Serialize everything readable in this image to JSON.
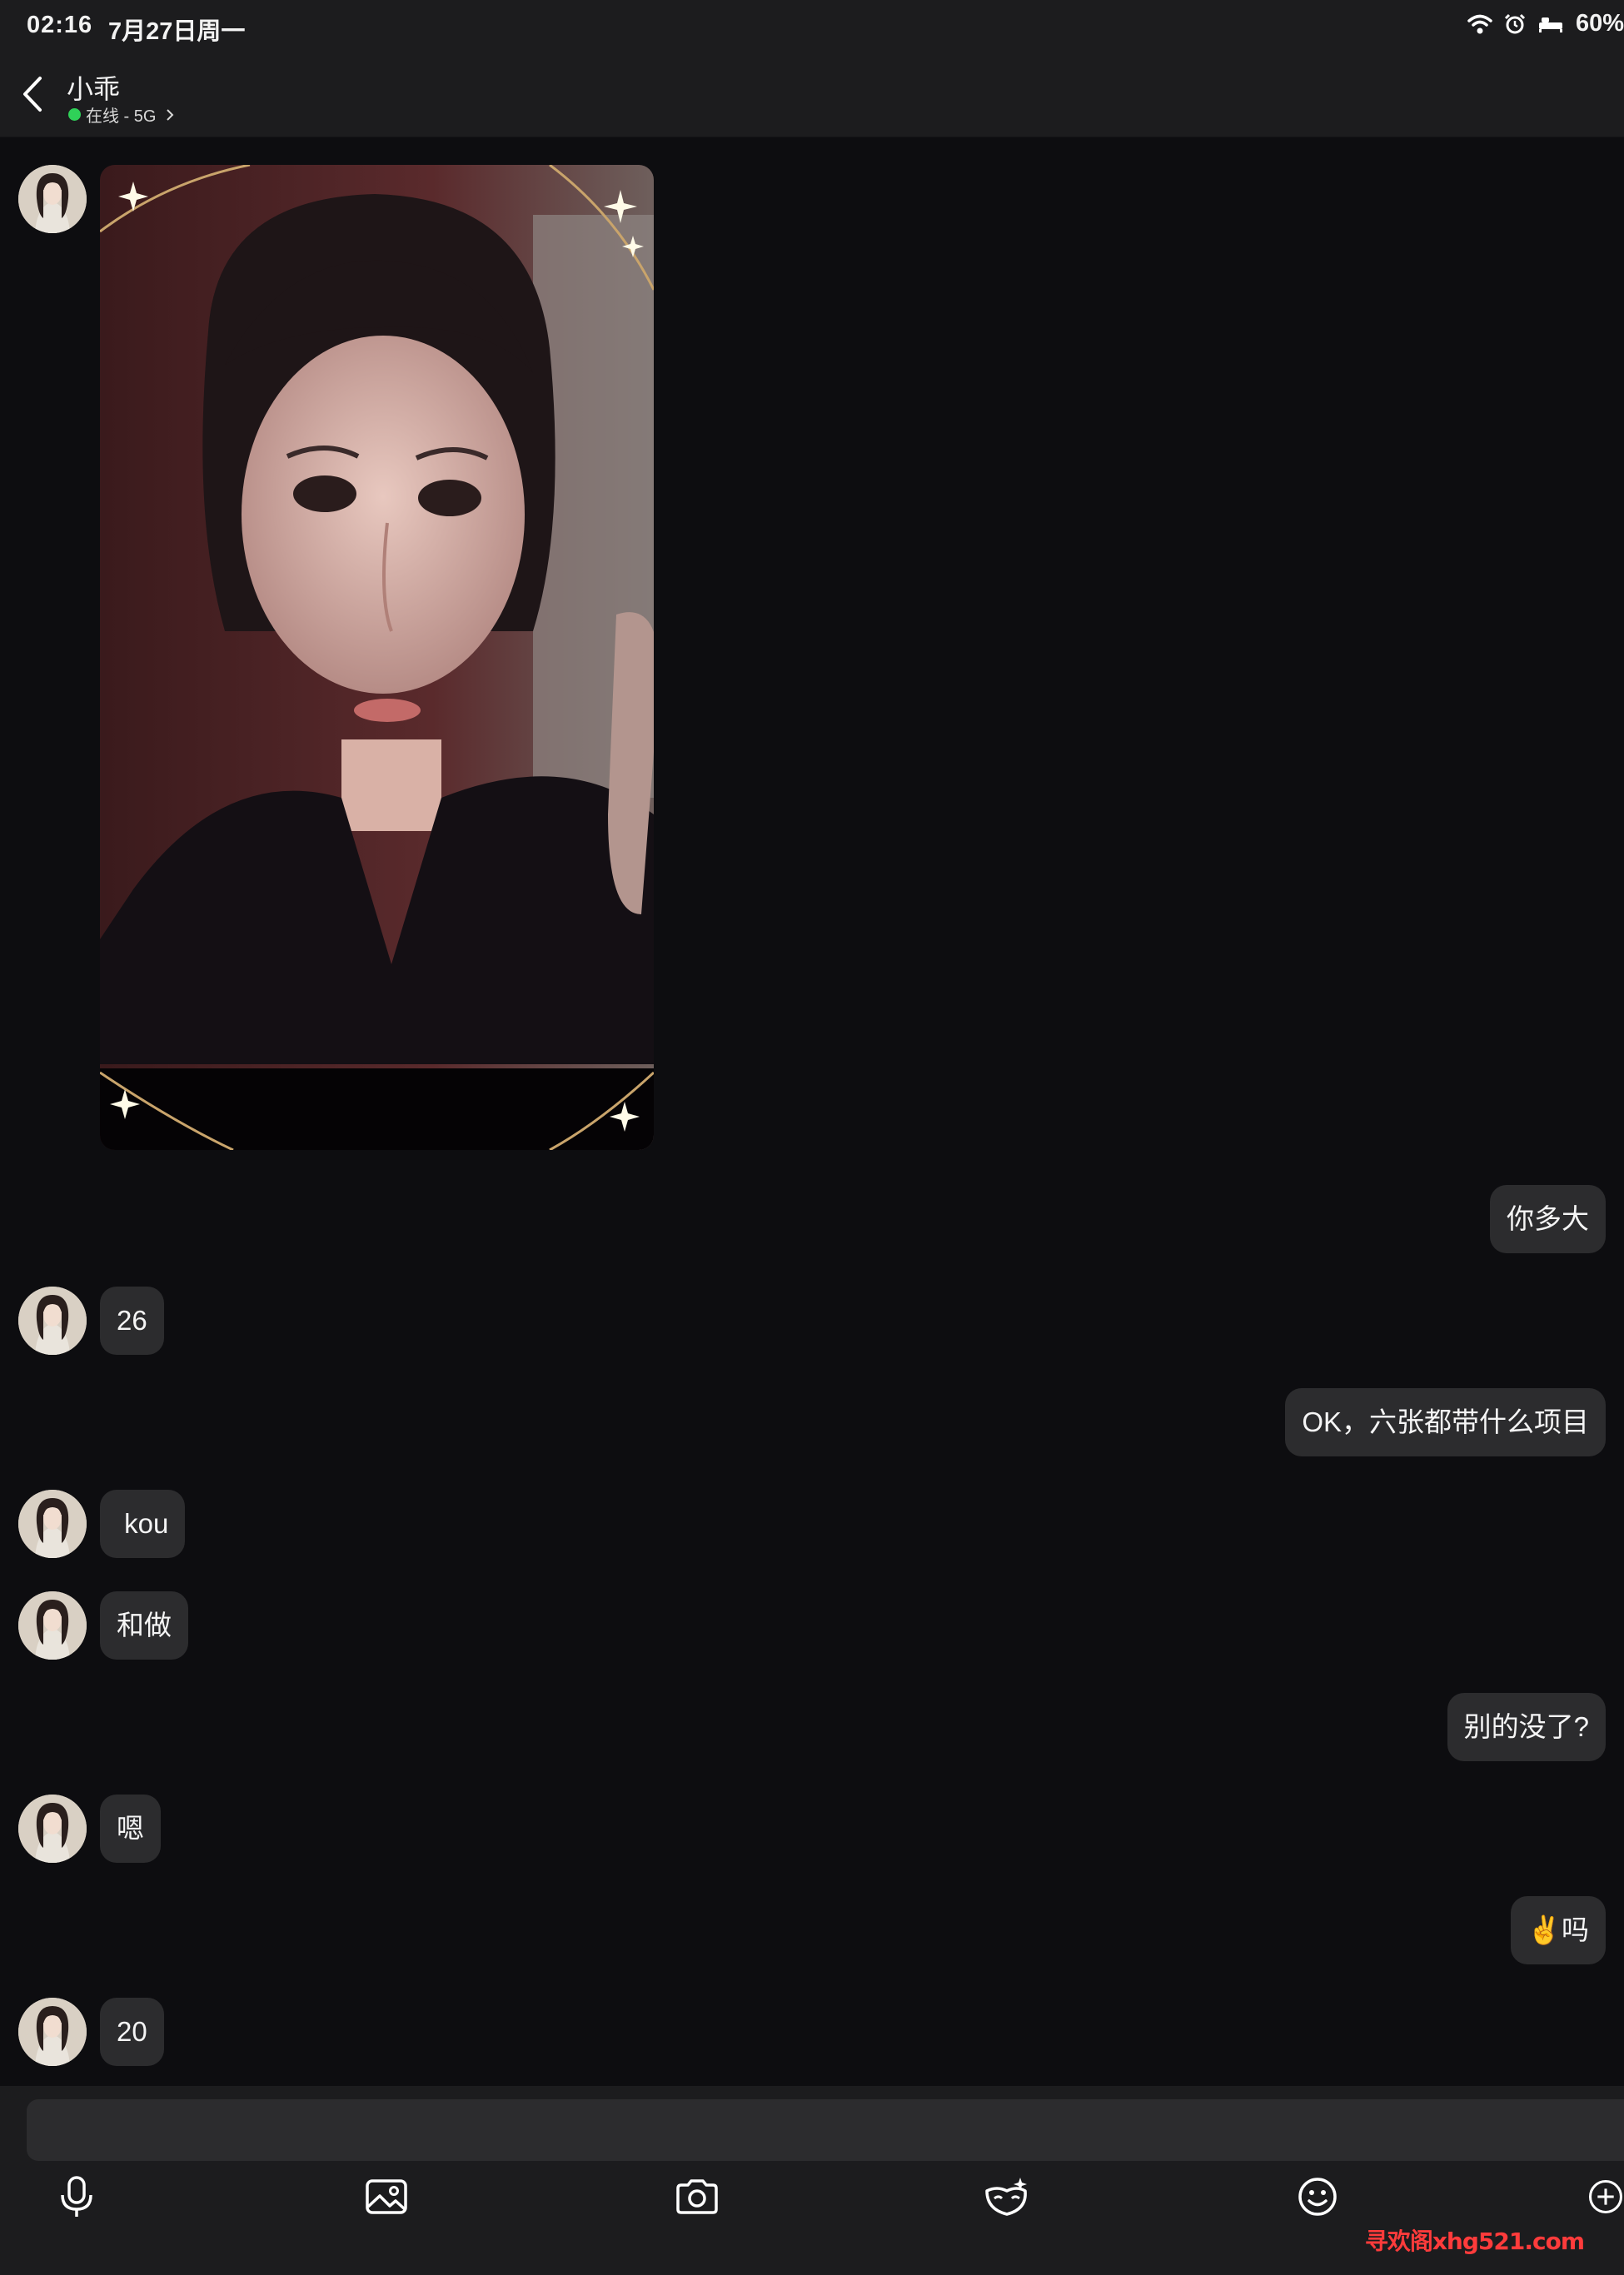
{
  "status_bar": {
    "time": "02:16",
    "date": "7月27日周一",
    "battery": "60%",
    "icons": [
      "wifi-icon",
      "alarm-icon",
      "bed-icon"
    ]
  },
  "header": {
    "back_icon": "chevron-left-icon",
    "contact_name": "小乖",
    "presence": "在线 - 5G",
    "presence_color": "#2fd158"
  },
  "messages": [
    {
      "side": "incoming",
      "type": "image",
      "content": "selfie-photo"
    },
    {
      "side": "outgoing",
      "type": "text",
      "text": "你多大"
    },
    {
      "side": "incoming",
      "type": "text",
      "text": "26"
    },
    {
      "side": "outgoing",
      "type": "text",
      "text": "OK，六张都带什么项目"
    },
    {
      "side": "incoming",
      "type": "text",
      "text": " kou"
    },
    {
      "side": "incoming",
      "type": "text",
      "text": "和做"
    },
    {
      "side": "outgoing",
      "type": "text",
      "text": "别的没了?"
    },
    {
      "side": "incoming",
      "type": "text",
      "text": "嗯"
    },
    {
      "side": "outgoing",
      "type": "text",
      "text": "✌️吗"
    },
    {
      "side": "incoming",
      "type": "text",
      "text": "20"
    }
  ],
  "composer": {
    "input_value": "",
    "toolbar": [
      "microphone-icon",
      "gallery-icon",
      "camera-icon",
      "mask-sticker-icon",
      "emoji-icon",
      "plus-icon"
    ]
  },
  "watermark": "寻欢阁xhg521.com",
  "colors": {
    "background": "#0d0d10",
    "bar": "#1c1c1e",
    "bubble": "#2c2c2e",
    "watermark": "#ff3b3b"
  }
}
